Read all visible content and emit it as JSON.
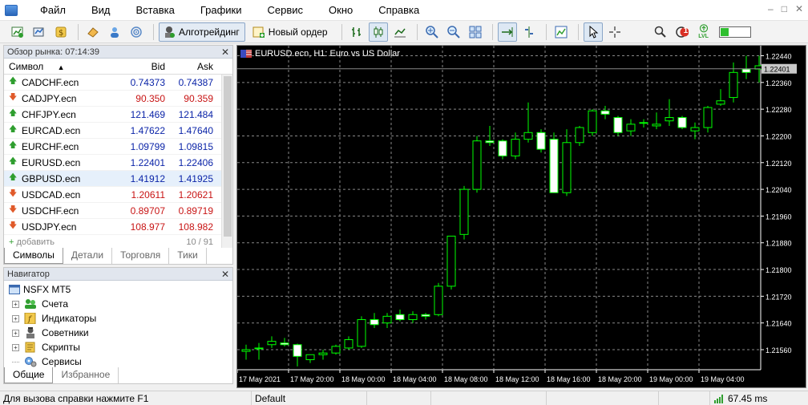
{
  "menu": [
    "Файл",
    "Вид",
    "Вставка",
    "Графики",
    "Сервис",
    "Окно",
    "Справка"
  ],
  "toolbar": {
    "algo_label": "Алготрейдинг",
    "new_order_label": "Новый ордер",
    "notification_count": "1",
    "lvl_label": "LVL"
  },
  "market_watch": {
    "title": "Обзор рынка: 07:14:39",
    "headers": {
      "symbol": "Символ",
      "bid": "Bid",
      "ask": "Ask"
    },
    "rows": [
      {
        "symbol": "CADCHF.ecn",
        "bid": "0.74373",
        "ask": "0.74387",
        "dir": "up",
        "color": "up"
      },
      {
        "symbol": "CADJPY.ecn",
        "bid": "90.350",
        "ask": "90.359",
        "dir": "down",
        "color": "down"
      },
      {
        "symbol": "CHFJPY.ecn",
        "bid": "121.469",
        "ask": "121.484",
        "dir": "up",
        "color": "up"
      },
      {
        "symbol": "EURCAD.ecn",
        "bid": "1.47622",
        "ask": "1.47640",
        "dir": "up",
        "color": "up"
      },
      {
        "symbol": "EURCHF.ecn",
        "bid": "1.09799",
        "ask": "1.09815",
        "dir": "up",
        "color": "up"
      },
      {
        "symbol": "EURUSD.ecn",
        "bid": "1.22401",
        "ask": "1.22406",
        "dir": "up",
        "color": "up"
      },
      {
        "symbol": "GBPUSD.ecn",
        "bid": "1.41912",
        "ask": "1.41925",
        "dir": "up",
        "color": "up"
      },
      {
        "symbol": "USDCAD.ecn",
        "bid": "1.20611",
        "ask": "1.20621",
        "dir": "down",
        "color": "down"
      },
      {
        "symbol": "USDCHF.ecn",
        "bid": "0.89707",
        "ask": "0.89719",
        "dir": "down",
        "color": "down"
      },
      {
        "symbol": "USDJPY.ecn",
        "bid": "108.977",
        "ask": "108.982",
        "dir": "down",
        "color": "down"
      }
    ],
    "add_label": "добавить",
    "count_label": "10 / 91",
    "tabs": [
      "Символы",
      "Детали",
      "Торговля",
      "Тики"
    ]
  },
  "navigator": {
    "title": "Навигатор",
    "root": "NSFX MT5",
    "items": [
      "Счета",
      "Индикаторы",
      "Советники",
      "Скрипты",
      "Сервисы"
    ],
    "tabs": [
      "Общие",
      "Избранное"
    ]
  },
  "chart": {
    "label": "EURUSD.ecn, H1:  Euro vs US Dollar",
    "current_price": "1.22401"
  },
  "chart_data": {
    "type": "candlestick",
    "title": "EURUSD.ecn, H1:  Euro vs US Dollar",
    "y_ticks": [
      "1.22440",
      "1.22360",
      "1.22280",
      "1.22200",
      "1.22120",
      "1.22040",
      "1.21960",
      "1.21880",
      "1.21800",
      "1.21720",
      "1.21640",
      "1.21560"
    ],
    "ylim": [
      1.215,
      1.2247
    ],
    "x_ticks": [
      "17 May 2021",
      "17 May 20:00",
      "18 May 00:00",
      "18 May 04:00",
      "18 May 08:00",
      "18 May 12:00",
      "18 May 16:00",
      "18 May 20:00",
      "19 May 00:00",
      "19 May 04:00"
    ],
    "grid": true,
    "colors": {
      "background": "#000000",
      "up": "#000000",
      "down": "#ffffff",
      "wick": "#00ff00",
      "grid": "#888888",
      "text": "#ffffff",
      "price_line": "#888888"
    },
    "candles": [
      [
        1.21555,
        1.21575,
        1.2153,
        1.2156
      ],
      [
        1.21565,
        1.2158,
        1.2153,
        1.21565
      ],
      [
        1.21575,
        1.216,
        1.21565,
        1.21585
      ],
      [
        1.2158,
        1.21595,
        1.2157,
        1.21575
      ],
      [
        1.21575,
        1.21578,
        1.2151,
        1.2154
      ],
      [
        1.2153,
        1.21545,
        1.2152,
        1.21545
      ],
      [
        1.21545,
        1.2156,
        1.2153,
        1.2155
      ],
      [
        1.2155,
        1.21575,
        1.21545,
        1.2157
      ],
      [
        1.21565,
        1.216,
        1.2156,
        1.2159
      ],
      [
        1.2157,
        1.2166,
        1.21565,
        1.2165
      ],
      [
        1.2165,
        1.2167,
        1.21625,
        1.21635
      ],
      [
        1.2164,
        1.2167,
        1.21625,
        1.2166
      ],
      [
        1.21665,
        1.2168,
        1.21645,
        1.2165
      ],
      [
        1.2165,
        1.21675,
        1.2164,
        1.21665
      ],
      [
        1.21665,
        1.2167,
        1.2165,
        1.2166
      ],
      [
        1.21665,
        1.2176,
        1.2166,
        1.2175
      ],
      [
        1.2175,
        1.219,
        1.2174,
        1.219
      ],
      [
        1.21905,
        1.2205,
        1.2189,
        1.2204
      ],
      [
        1.2204,
        1.222,
        1.2203,
        1.22185
      ],
      [
        1.22185,
        1.2223,
        1.2217,
        1.2218
      ],
      [
        1.22185,
        1.2219,
        1.2213,
        1.2214
      ],
      [
        1.2214,
        1.2221,
        1.2213,
        1.2219
      ],
      [
        1.2219,
        1.223,
        1.2218,
        1.2221
      ],
      [
        1.2221,
        1.2222,
        1.2215,
        1.2216
      ],
      [
        1.2219,
        1.2221,
        1.2203,
        1.2203
      ],
      [
        1.2203,
        1.2222,
        1.2202,
        1.2218
      ],
      [
        1.2218,
        1.2223,
        1.2217,
        1.22225
      ],
      [
        1.2221,
        1.2228,
        1.222,
        1.22275
      ],
      [
        1.22275,
        1.2229,
        1.2225,
        1.22265
      ],
      [
        1.22255,
        1.2226,
        1.222,
        1.2221
      ],
      [
        1.22215,
        1.2225,
        1.222,
        1.22235
      ],
      [
        1.2224,
        1.2225,
        1.22225,
        1.2224
      ],
      [
        1.2223,
        1.2227,
        1.2222,
        1.22235
      ],
      [
        1.22245,
        1.2231,
        1.2223,
        1.22255
      ],
      [
        1.22255,
        1.2226,
        1.2222,
        1.22225
      ],
      [
        1.22215,
        1.2224,
        1.2219,
        1.22225
      ],
      [
        1.22225,
        1.2229,
        1.2221,
        1.22285
      ],
      [
        1.22295,
        1.2234,
        1.2229,
        1.22305
      ],
      [
        1.22315,
        1.2242,
        1.223,
        1.2239
      ],
      [
        1.224,
        1.2244,
        1.2237,
        1.2239
      ],
      [
        1.224,
        1.2244,
        1.2236,
        1.2241
      ]
    ]
  },
  "status": {
    "help": "Для вызова справки нажмите F1",
    "profile": "Default",
    "ping": "67.45 ms"
  }
}
